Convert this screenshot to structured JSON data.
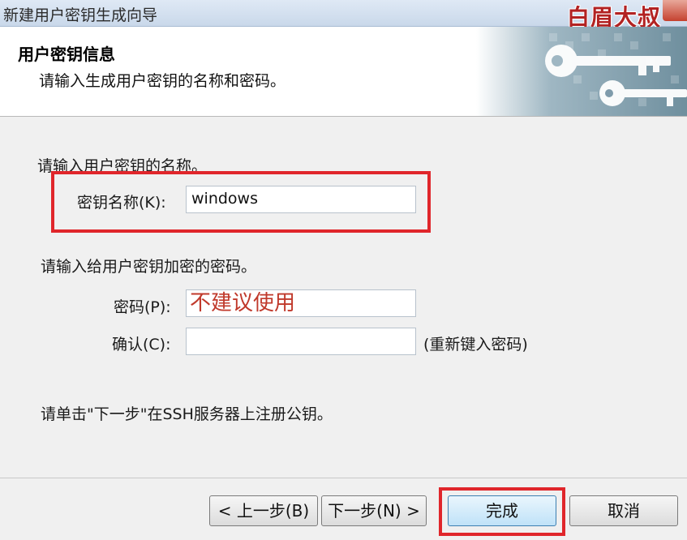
{
  "window": {
    "title": "新建用户密钥生成向导",
    "watermark": "白眉大叔"
  },
  "header": {
    "title": "用户密钥信息",
    "subtitle": "请输入生成用户密钥的名称和密码。"
  },
  "form": {
    "name_prompt": "请输入用户密钥的名称。",
    "key_name_label": "密钥名称(K):",
    "key_name_value": "windows",
    "password_prompt": "请输入给用户密钥加密的密码。",
    "password_label": "密码(P):",
    "password_value": "不建议使用",
    "confirm_label": "确认(C):",
    "confirm_value": "",
    "confirm_hint": "(重新键入密码)",
    "register_note": "请单击\"下一步\"在SSH服务器上注册公钥。"
  },
  "buttons": {
    "back": "< 上一步(B)",
    "next": "下一步(N) >",
    "finish": "完成",
    "cancel": "取消"
  },
  "colors": {
    "highlight": "#e0262b",
    "annotation_text": "#c0392b",
    "primary_button": "#bfe2f8"
  }
}
